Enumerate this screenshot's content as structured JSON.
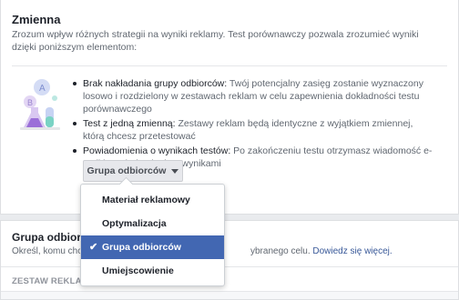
{
  "section": {
    "title": "Zmienna",
    "description": "Zrozum wpływ różnych strategii na wyniki reklamy. Test porównawczy pozwala zrozumieć wyniki dzięki poniższym elementom:",
    "bullets": [
      {
        "title": "Brak nakładania grupy odbiorców:",
        "text": " Twój potencjalny zasięg zostanie wyznaczony losowo i rozdzielony w zestawach reklam w celu zapewnienia dokładności testu porównawczego"
      },
      {
        "title": "Test z jedną zmienną:",
        "text": " Zestawy reklam będą identyczne z wyjątkiem zmiennej, którą chcesz przetestować"
      },
      {
        "title": "Powiadomienia o wynikach testów:",
        "text": " Po zakończeniu testu otrzymasz wiadomość e-mail i powiadomienie z wynikami"
      }
    ],
    "dropdown_label": "Grupa odbiorców"
  },
  "menu": {
    "items": [
      {
        "label": "Materiał reklamowy",
        "selected": false
      },
      {
        "label": "Optymalizacja wyświetlania",
        "selected": false
      },
      {
        "label": "Grupa odbiorców",
        "selected": true
      },
      {
        "label": "Umiejscowienie",
        "selected": false
      }
    ],
    "check_glyph": "✔"
  },
  "audience": {
    "title": "Grupa odbiorc",
    "desc_left": "Określ, komu chce",
    "desc_right": "ybranego celu.",
    "link": "Dowiedz się więcej.",
    "section_label": "ZESTAW REKLAM"
  },
  "colors": {
    "accent": "#4267b2",
    "link": "#385898"
  }
}
